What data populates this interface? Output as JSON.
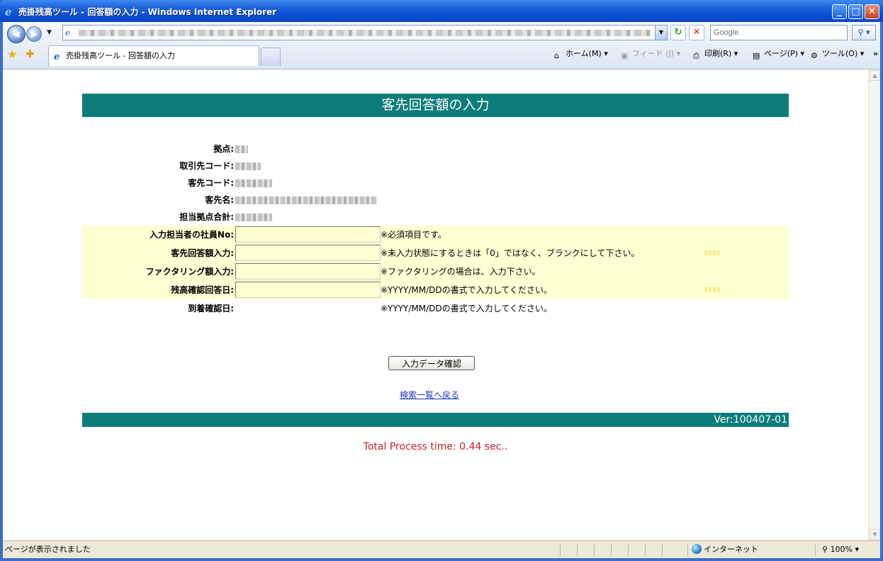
{
  "window": {
    "title": "売掛残高ツール - 回答額の入力 - Windows Internet Explorer"
  },
  "toolbar": {
    "search_placeholder": "Google",
    "tab_title": "売掛残高ツール - 回答額の入力",
    "home_label": "ホーム(M)",
    "feed_label": "フィード (J)",
    "print_label": "印刷(R)",
    "page_label": "ページ(P)",
    "tools_label": "ツール(O)"
  },
  "page": {
    "heading": "客先回答額の入力",
    "fields": [
      {
        "label": "拠点:"
      },
      {
        "label": "取引先コード:"
      },
      {
        "label": "客先コード:"
      },
      {
        "label": "客先名:"
      },
      {
        "label": "担当拠点合計:"
      }
    ],
    "inputs": [
      {
        "label": "入力担当者の社員No:",
        "value": "",
        "note": "※必須項目です。"
      },
      {
        "label": "客先回答額入力:",
        "value": "",
        "note": "※未入力状態にするときは「0」ではなく、ブランクにして下さい。"
      },
      {
        "label": "ファクタリング額入力:",
        "value": "",
        "note": "※ファクタリングの場合は、入力下さい。"
      },
      {
        "label": "残高確認回答日:",
        "value": "",
        "note": "※YYYY/MM/DDの書式で入力してください。"
      }
    ],
    "arrival": {
      "label": "到着確認日:",
      "note": "※YYYY/MM/DDの書式で入力してください。"
    },
    "confirm_button": "入力データ確認",
    "back_link": "検索一覧へ戻る",
    "version": "Ver:100407-01",
    "process_time": "Total Process time: 0.44 sec.."
  },
  "statusbar": {
    "text": "ページが表示されました",
    "zone": "インターネット",
    "zoom": "100%"
  },
  "colors": {
    "band": "#0d7d79",
    "highlight": "#ffffd4",
    "process_time": "#c8202a"
  }
}
